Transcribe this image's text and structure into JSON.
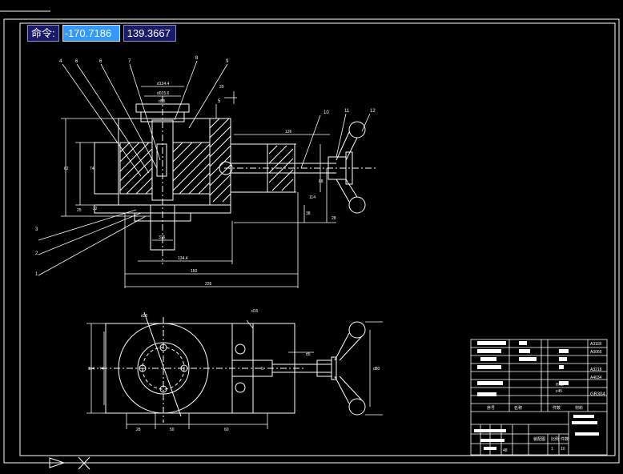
{
  "command_bar": {
    "label": "命令:",
    "x_value": "-170.7186",
    "y_value": "139.3667"
  },
  "callouts": [
    "4",
    "6",
    "6",
    "7",
    "8",
    "9",
    "10",
    "11",
    "12",
    "3",
    "2",
    "1",
    "5"
  ],
  "dimensions": {
    "d1": "d134.4",
    "d2": "d015.6",
    "d3": "d55",
    "top_right": "20",
    "len_126": "126",
    "slot": "316",
    "width1": "134.4",
    "width2": "150",
    "width3": "226",
    "left_62": "62",
    "left_74": "74",
    "front_114": "114",
    "front_88": "88",
    "front_38": "38",
    "front_28": "28",
    "front_25": "25",
    "front_22": "22",
    "plan_d1": "d20",
    "plan_d2": "d15",
    "plan_114": "114",
    "plan_74": "74",
    "plan_d80": "d80",
    "plan_28": "28",
    "plan_50": "50",
    "plan_60": "60",
    "plan_d5": "d5",
    "plan_6": "6"
  },
  "title_block": {
    "right_col": [
      "A3118",
      "A0066",
      "A3218",
      "A4034",
      "GB304"
    ],
    "mid_labels": [
      "HT2",
      "c45"
    ],
    "footer_labels": [
      "序号",
      "名称",
      "件数",
      "材料"
    ],
    "bottom_codes": [
      "装配图",
      "比例",
      "件数"
    ],
    "bottom_nums": [
      "1",
      "10",
      "48"
    ]
  },
  "ucs": {
    "x_label": "X"
  }
}
